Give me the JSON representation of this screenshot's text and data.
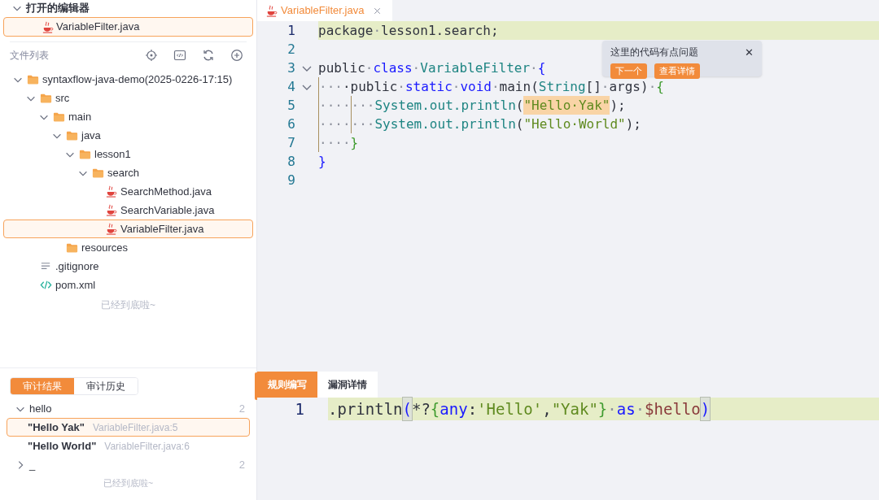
{
  "open_editors": {
    "title": "打开的编辑器",
    "expanded": true,
    "files": [
      {
        "name": "VariableFilter.java",
        "selected": true
      }
    ]
  },
  "file_list": {
    "title": "文件列表",
    "tree": [
      {
        "name": "syntaxflow-java-demo(2025-0226-17:15)",
        "kind": "folder",
        "expanded": true,
        "children": [
          {
            "name": "src",
            "kind": "folder",
            "expanded": true,
            "children": [
              {
                "name": "main",
                "kind": "folder",
                "expanded": true,
                "children": [
                  {
                    "name": "java",
                    "kind": "folder",
                    "expanded": true,
                    "children": [
                      {
                        "name": "lesson1",
                        "kind": "folder",
                        "expanded": true,
                        "children": [
                          {
                            "name": "search",
                            "kind": "folder",
                            "expanded": true,
                            "children": [
                              {
                                "name": "SearchMethod.java",
                                "kind": "java",
                                "selected": false
                              },
                              {
                                "name": "SearchVariable.java",
                                "kind": "java",
                                "selected": false
                              },
                              {
                                "name": "VariableFilter.java",
                                "kind": "java",
                                "selected": true
                              }
                            ]
                          }
                        ]
                      }
                    ]
                  },
                  {
                    "name": "resources",
                    "kind": "folder",
                    "expanded": false
                  }
                ]
              }
            ]
          },
          {
            "name": ".gitignore",
            "kind": "text",
            "selected": false
          },
          {
            "name": "pom.xml",
            "kind": "xml",
            "selected": false
          }
        ]
      }
    ],
    "end_note": "已经到底啦~"
  },
  "audit_tabs": [
    {
      "label": "审计结果",
      "selected": true
    },
    {
      "label": "审计历史",
      "selected": false
    }
  ],
  "results": [
    {
      "label": "hello",
      "count": "2",
      "expanded": true,
      "items": [
        {
          "value": "\"Hello Yak\"",
          "location": "VariableFilter.java:5",
          "selected": true
        },
        {
          "value": "\"Hello World\"",
          "location": "VariableFilter.java:6",
          "selected": false
        }
      ]
    },
    {
      "label": "_",
      "count": "2",
      "expanded": false
    }
  ],
  "results_end_note": "已经到底啦~",
  "editor_tabs": [
    {
      "name": "VariableFilter.java",
      "selected": true
    }
  ],
  "code": [
    {
      "n": "1",
      "highlighted": true,
      "fold": false,
      "tokens": [
        {
          "t": "package",
          "kind": "plain"
        },
        {
          "t": "·",
          "kind": "space"
        },
        {
          "t": "lesson1.search;",
          "kind": "plain"
        }
      ]
    },
    {
      "n": "2",
      "highlighted": false,
      "fold": false
    },
    {
      "n": "3",
      "highlighted": false,
      "fold": true,
      "tokens": [
        {
          "t": "public",
          "kind": "plain"
        },
        {
          "t": "·",
          "kind": "space"
        },
        {
          "t": "class",
          "kind": "keyword"
        },
        {
          "t": "·",
          "kind": "space"
        },
        {
          "t": "VariableFilter",
          "kind": "type"
        },
        {
          "t": "·",
          "kind": "space"
        },
        {
          "t": "{",
          "kind": "brace"
        }
      ]
    },
    {
      "n": "4",
      "highlighted": false,
      "fold": true,
      "tokens": [
        {
          "t": "···",
          "kind": "indent"
        },
        {
          "t": "·public",
          "kind": "plain"
        },
        {
          "t": "·",
          "kind": "space"
        },
        {
          "t": "static",
          "kind": "keyword"
        },
        {
          "t": "·",
          "kind": "space"
        },
        {
          "t": "void",
          "kind": "keyword"
        },
        {
          "t": "·",
          "kind": "space"
        },
        {
          "t": "main(",
          "kind": "plain"
        },
        {
          "t": "String",
          "kind": "type"
        },
        {
          "t": "[]",
          "kind": "plain"
        },
        {
          "t": "·",
          "kind": "space"
        },
        {
          "t": "args)",
          "kind": "plain"
        },
        {
          "t": "·",
          "kind": "space"
        },
        {
          "t": "{",
          "kind": "inner-brace"
        }
      ]
    },
    {
      "n": "5",
      "highlighted": false,
      "fold": false,
      "tokens": [
        {
          "t": "····",
          "kind": "indent"
        },
        {
          "t": "···",
          "kind": "indent"
        },
        {
          "t": "System.out.println",
          "kind": "type"
        },
        {
          "t": "(",
          "kind": "plain"
        },
        {
          "t": "\"Hello·Yak\"",
          "kind": "match"
        },
        {
          "t": ");",
          "kind": "plain"
        }
      ]
    },
    {
      "n": "6",
      "highlighted": false,
      "fold": false,
      "tokens": [
        {
          "t": "····",
          "kind": "indent"
        },
        {
          "t": "···",
          "kind": "indent"
        },
        {
          "t": "System.out.println",
          "kind": "type"
        },
        {
          "t": "(",
          "kind": "plain"
        },
        {
          "t": "\"Hello·World\"",
          "kind": "string"
        },
        {
          "t": ");",
          "kind": "plain"
        }
      ]
    },
    {
      "n": "7",
      "highlighted": false,
      "fold": false,
      "tokens": [
        {
          "t": "····",
          "kind": "indent"
        },
        {
          "t": "}",
          "kind": "inner-brace"
        }
      ]
    },
    {
      "n": "8",
      "highlighted": false,
      "fold": false,
      "tokens": [
        {
          "t": "}",
          "kind": "brace"
        }
      ]
    },
    {
      "n": "9",
      "highlighted": false,
      "fold": false
    }
  ],
  "popup": {
    "message": "这里的代码有点问题",
    "close": "✕",
    "buttons": [
      "下一个",
      "查看详情"
    ]
  },
  "bottom_tabs": [
    {
      "label": "规则编写",
      "selected": true
    },
    {
      "label": "漏洞详情",
      "selected": false
    }
  ],
  "rule_code": [
    {
      "n": "1",
      "highlighted": true,
      "tokens": [
        {
          "t": ".println",
          "kind": "plain"
        },
        {
          "t": "(",
          "kind": "bracket"
        },
        {
          "t": "*?",
          "kind": "plain"
        },
        {
          "t": "{",
          "kind": "inner-brace"
        },
        {
          "t": "any",
          "kind": "keyword"
        },
        {
          "t": ":",
          "kind": "plain"
        },
        {
          "t": "'Hello'",
          "kind": "string"
        },
        {
          "t": ",",
          "kind": "plain"
        },
        {
          "t": "\"Yak\"",
          "kind": "string"
        },
        {
          "t": "}",
          "kind": "inner-brace"
        },
        {
          "t": "·",
          "kind": "space"
        },
        {
          "t": "as",
          "kind": "keyword"
        },
        {
          "t": "·",
          "kind": "space"
        },
        {
          "t": "$hello",
          "kind": "variable"
        },
        {
          "t": ")",
          "kind": "bracket"
        }
      ]
    }
  ]
}
